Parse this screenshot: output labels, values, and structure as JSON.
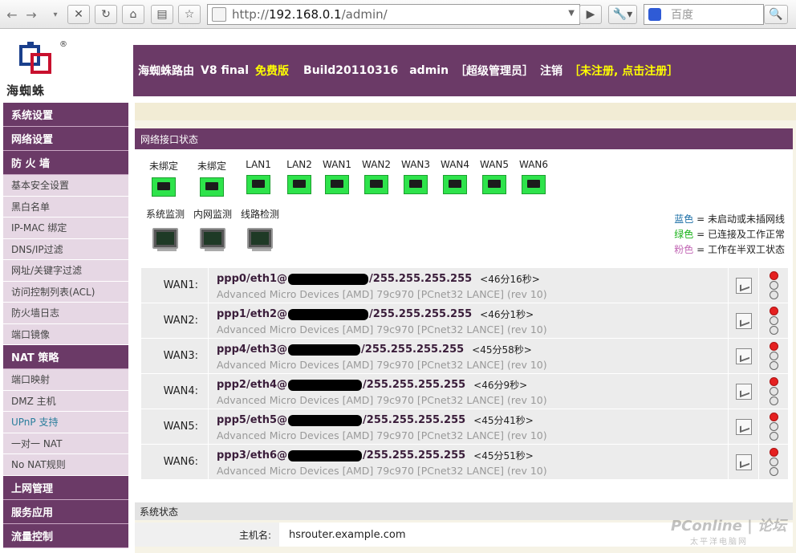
{
  "browser": {
    "url_prefix": "http://",
    "url_host": "192.168.0.1",
    "url_path": "/admin/",
    "search_placeholder": "百度"
  },
  "logo": {
    "text": "海蜘蛛",
    "mark": "®"
  },
  "banner": {
    "product": "海蜘蛛路由",
    "version": "V8 final",
    "edition": "免费版",
    "build": "Build20110316",
    "user": "admin",
    "role": "［超级管理员］",
    "logout": "注销",
    "register": "［未注册, 点击注册］"
  },
  "sidebar": [
    {
      "type": "group",
      "label": "系统设置"
    },
    {
      "type": "group",
      "label": "网络设置"
    },
    {
      "type": "group",
      "label": "防 火 墙"
    },
    {
      "type": "item",
      "label": "基本安全设置"
    },
    {
      "type": "item",
      "label": "黑白名单"
    },
    {
      "type": "item",
      "label": "IP-MAC 绑定"
    },
    {
      "type": "item",
      "label": "DNS/IP过滤"
    },
    {
      "type": "item",
      "label": "网址/关键字过滤"
    },
    {
      "type": "item",
      "label": "访问控制列表(ACL)"
    },
    {
      "type": "item",
      "label": "防火墙日志"
    },
    {
      "type": "item",
      "label": "端口镜像"
    },
    {
      "type": "group",
      "label": "NAT 策略"
    },
    {
      "type": "item",
      "label": "端口映射"
    },
    {
      "type": "item",
      "label": "DMZ 主机"
    },
    {
      "type": "item",
      "label": "UPnP 支持",
      "selected": true
    },
    {
      "type": "item",
      "label": "一对一 NAT"
    },
    {
      "type": "item",
      "label": "No NAT规则"
    },
    {
      "type": "group",
      "label": "上网管理"
    },
    {
      "type": "group",
      "label": "服务应用"
    },
    {
      "type": "group",
      "label": "流量控制"
    }
  ],
  "interfaces": {
    "title": "网络接口状态",
    "ports": [
      "未绑定",
      "未绑定",
      "LAN1",
      "LAN2",
      "WAN1",
      "WAN2",
      "WAN3",
      "WAN4",
      "WAN5",
      "WAN6"
    ],
    "monitors": [
      "系统监测",
      "内网监测",
      "线路检测"
    ],
    "legend": [
      {
        "color_word": "蓝色",
        "text": " = 未启动或未插网线",
        "cls": "c-blue"
      },
      {
        "color_word": "绿色",
        "text": " = 已连接及工作正常",
        "cls": "c-green"
      },
      {
        "color_word": "粉色",
        "text": " = 工作在半双工状态",
        "cls": "c-pink"
      }
    ]
  },
  "wans": [
    {
      "name": "WAN1:",
      "iface": "ppp0/eth1@",
      "mask": "/255.255.255.255",
      "uptime": "<46分16秒>",
      "nic": "Advanced Micro Devices [AMD] 79c970 [PCnet32 LANCE] (rev 10)"
    },
    {
      "name": "WAN2:",
      "iface": "ppp1/eth2@",
      "mask": "/255.255.255.255",
      "uptime": "<46分1秒>",
      "nic": "Advanced Micro Devices [AMD] 79c970 [PCnet32 LANCE] (rev 10)"
    },
    {
      "name": "WAN3:",
      "iface": "ppp4/eth3@",
      "mask": "/255.255.255.255",
      "uptime": "<45分58秒>",
      "nic": "Advanced Micro Devices [AMD] 79c970 [PCnet32 LANCE] (rev 10)"
    },
    {
      "name": "WAN4:",
      "iface": "ppp2/eth4@",
      "mask": "/255.255.255.255",
      "uptime": "<46分9秒>",
      "nic": "Advanced Micro Devices [AMD] 79c970 [PCnet32 LANCE] (rev 10)"
    },
    {
      "name": "WAN5:",
      "iface": "ppp5/eth5@",
      "mask": "/255.255.255.255",
      "uptime": "<45分41秒>",
      "nic": "Advanced Micro Devices [AMD] 79c970 [PCnet32 LANCE] (rev 10)"
    },
    {
      "name": "WAN6:",
      "iface": "ppp3/eth6@",
      "mask": "/255.255.255.255",
      "uptime": "<45分51秒>",
      "nic": "Advanced Micro Devices [AMD] 79c970 [PCnet32 LANCE] (rev 10)"
    }
  ],
  "system": {
    "title": "系统状态",
    "hostname_label": "主机名:",
    "hostname": "hsrouter.example.com"
  },
  "watermark": {
    "brand": "PConline",
    "tag": "论坛",
    "sub": "太平洋电脑网"
  },
  "colors": {
    "brand": "#6b3a67",
    "port_ok": "#2ee34b",
    "light_red": "#e52121"
  }
}
